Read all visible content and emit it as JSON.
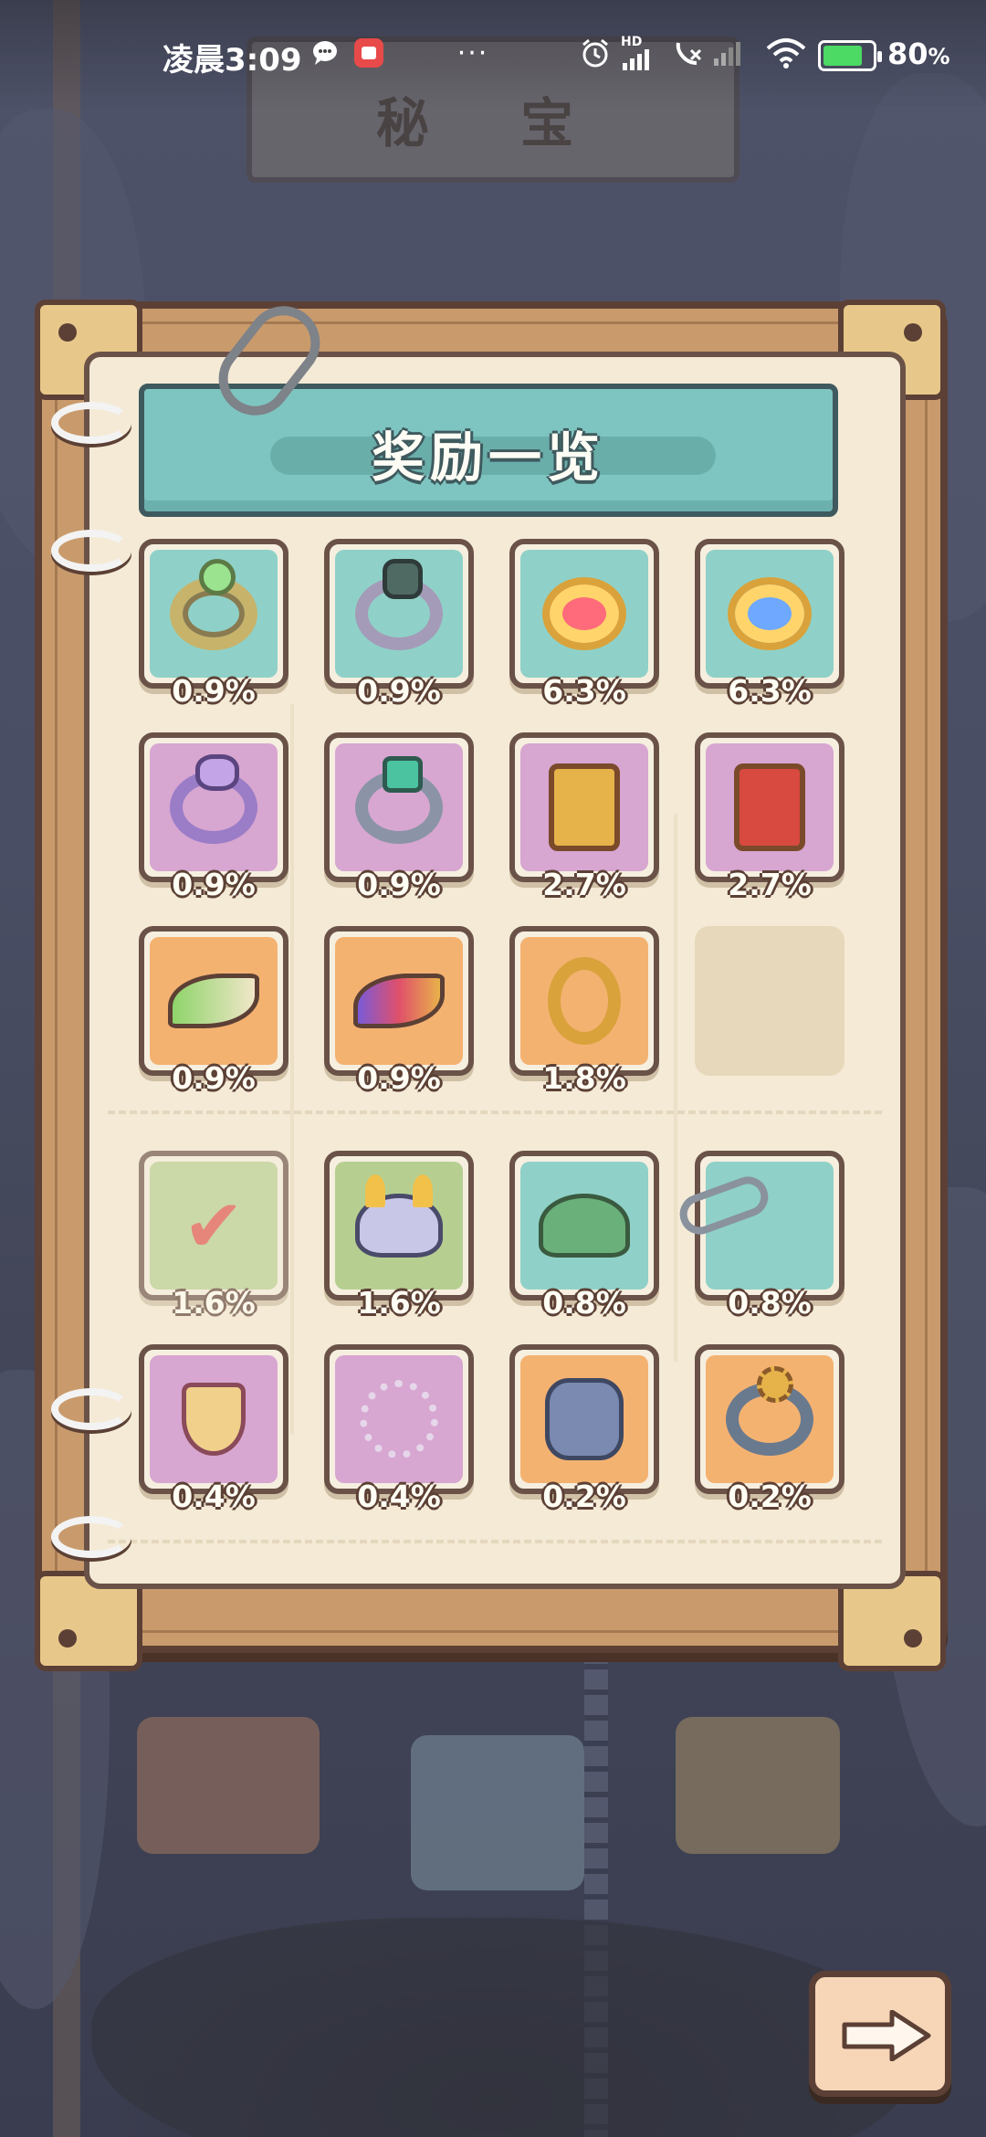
{
  "status_bar": {
    "time": "凌晨3:09",
    "dots": "···",
    "hd_label": "HD",
    "battery_percent": 80,
    "battery_label": "80",
    "battery_unit": "%"
  },
  "header": {
    "title": "秘 宝"
  },
  "panel": {
    "title": "奖励一览",
    "sections": [
      {
        "rows": [
          [
            {
              "color": "teal",
              "item": "green-gem-ring-icon",
              "chance": "0.9%"
            },
            {
              "color": "teal",
              "item": "clover-ring-icon",
              "chance": "0.9%"
            },
            {
              "color": "teal",
              "item": "ruby-amulet-icon",
              "chance": "6.3%"
            },
            {
              "color": "teal",
              "item": "sapphire-amulet-icon",
              "chance": "6.3%"
            }
          ],
          [
            {
              "color": "purple",
              "item": "amethyst-dragon-ring-icon",
              "chance": "0.9%"
            },
            {
              "color": "purple",
              "item": "emerald-claw-ring-icon",
              "chance": "0.9%"
            },
            {
              "color": "purple",
              "item": "gold-charm-icon",
              "chance": "2.7%"
            },
            {
              "color": "purple",
              "item": "red-charm-icon",
              "chance": "2.7%"
            }
          ],
          [
            {
              "color": "orange",
              "item": "green-wing-ring-icon",
              "chance": "0.9%"
            },
            {
              "color": "orange",
              "item": "rainbow-wing-ring-icon",
              "chance": "0.9%"
            },
            {
              "color": "orange",
              "item": "ornate-gold-ring-icon",
              "chance": "1.8%"
            },
            {
              "color": "empty",
              "item": "empty-slot",
              "chance": ""
            }
          ]
        ]
      },
      {
        "rows": [
          [
            {
              "color": "green",
              "item": "check-card-icon",
              "chance": "1.6%",
              "faded": true
            },
            {
              "color": "green",
              "item": "horned-helmet-icon",
              "chance": "1.6%"
            },
            {
              "color": "teal",
              "item": "leaf-crown-icon",
              "chance": "0.8%"
            },
            {
              "color": "teal",
              "item": "chain-tread-icon",
              "chance": "0.8%"
            }
          ],
          [
            {
              "color": "purple",
              "item": "shield-pendant-icon",
              "chance": "0.4%"
            },
            {
              "color": "purple",
              "item": "star-bracelet-icon",
              "chance": "0.4%"
            },
            {
              "color": "orange",
              "item": "golem-armor-icon",
              "chance": "0.2%"
            },
            {
              "color": "orange",
              "item": "gear-ring-icon",
              "chance": "0.2%"
            }
          ]
        ]
      }
    ]
  },
  "next_button": {
    "icon": "arrow-right-icon"
  },
  "colors": {
    "teal": "#8fd1c8",
    "purple": "#d7a6d1",
    "orange": "#f4b271",
    "green": "#b6cf91",
    "frame": "#c99b6c",
    "paper": "#f4ead6"
  }
}
